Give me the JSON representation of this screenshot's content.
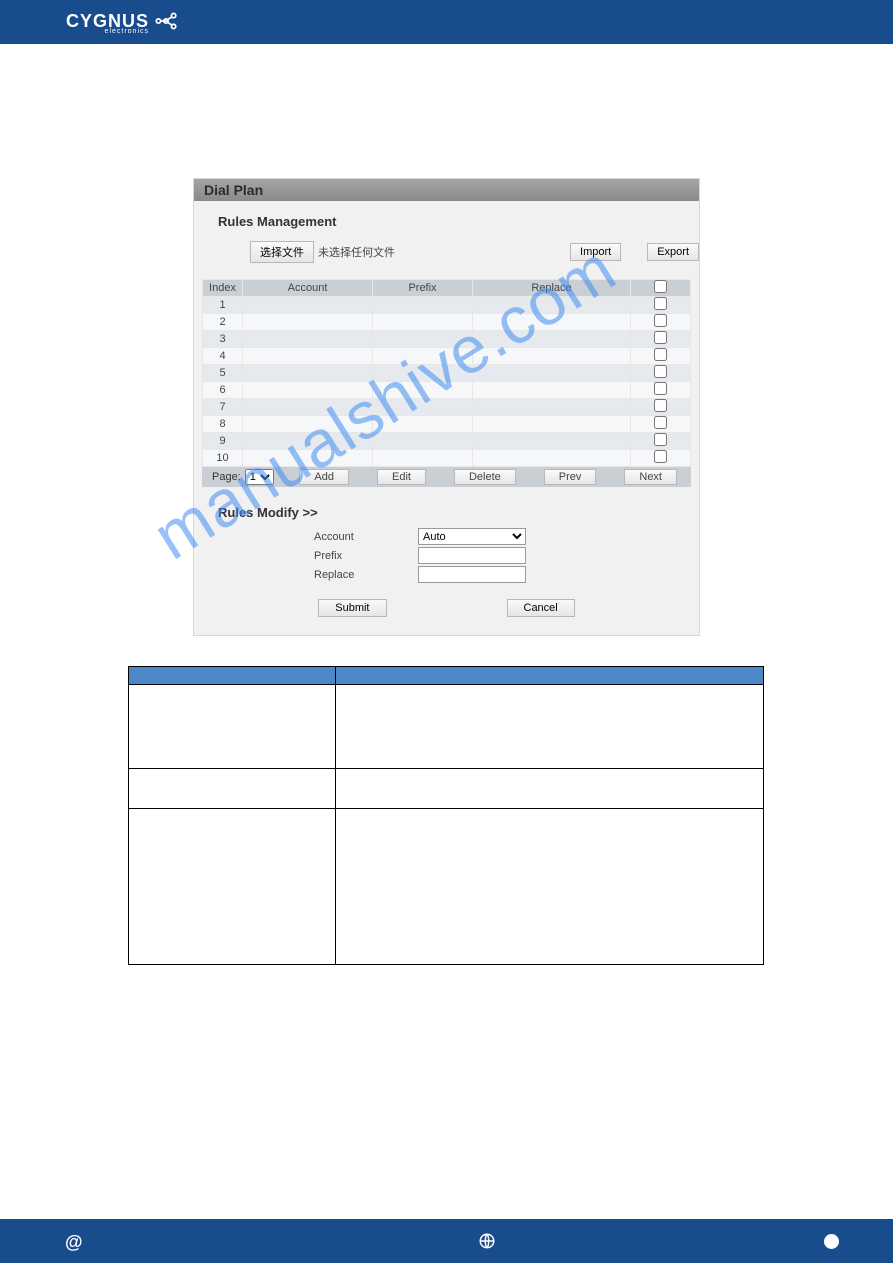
{
  "brand": {
    "name": "CYGNUS",
    "sub": "electronics"
  },
  "panel": {
    "title": "Dial Plan",
    "rules_management_label": "Rules Management",
    "choose_file_btn": "选择文件",
    "no_file_text": "未选择任何文件",
    "import_btn": "Import",
    "export_btn": "Export",
    "columns": {
      "index": "Index",
      "account": "Account",
      "prefix": "Prefix",
      "replace": "Replace"
    },
    "rows": [
      {
        "index": "1"
      },
      {
        "index": "2"
      },
      {
        "index": "3"
      },
      {
        "index": "4"
      },
      {
        "index": "5"
      },
      {
        "index": "6"
      },
      {
        "index": "7"
      },
      {
        "index": "8"
      },
      {
        "index": "9"
      },
      {
        "index": "10"
      }
    ],
    "pager": {
      "label": "Page:",
      "selected": "1",
      "add": "Add",
      "edit": "Edit",
      "delete": "Delete",
      "prev": "Prev",
      "next": "Next"
    },
    "modify": {
      "title": "Rules Modify >>",
      "account_label": "Account",
      "prefix_label": "Prefix",
      "replace_label": "Replace",
      "account_value": "Auto",
      "prefix_value": "",
      "replace_value": "",
      "submit": "Submit",
      "cancel": "Cancel"
    }
  },
  "watermark": "manualshive.com"
}
